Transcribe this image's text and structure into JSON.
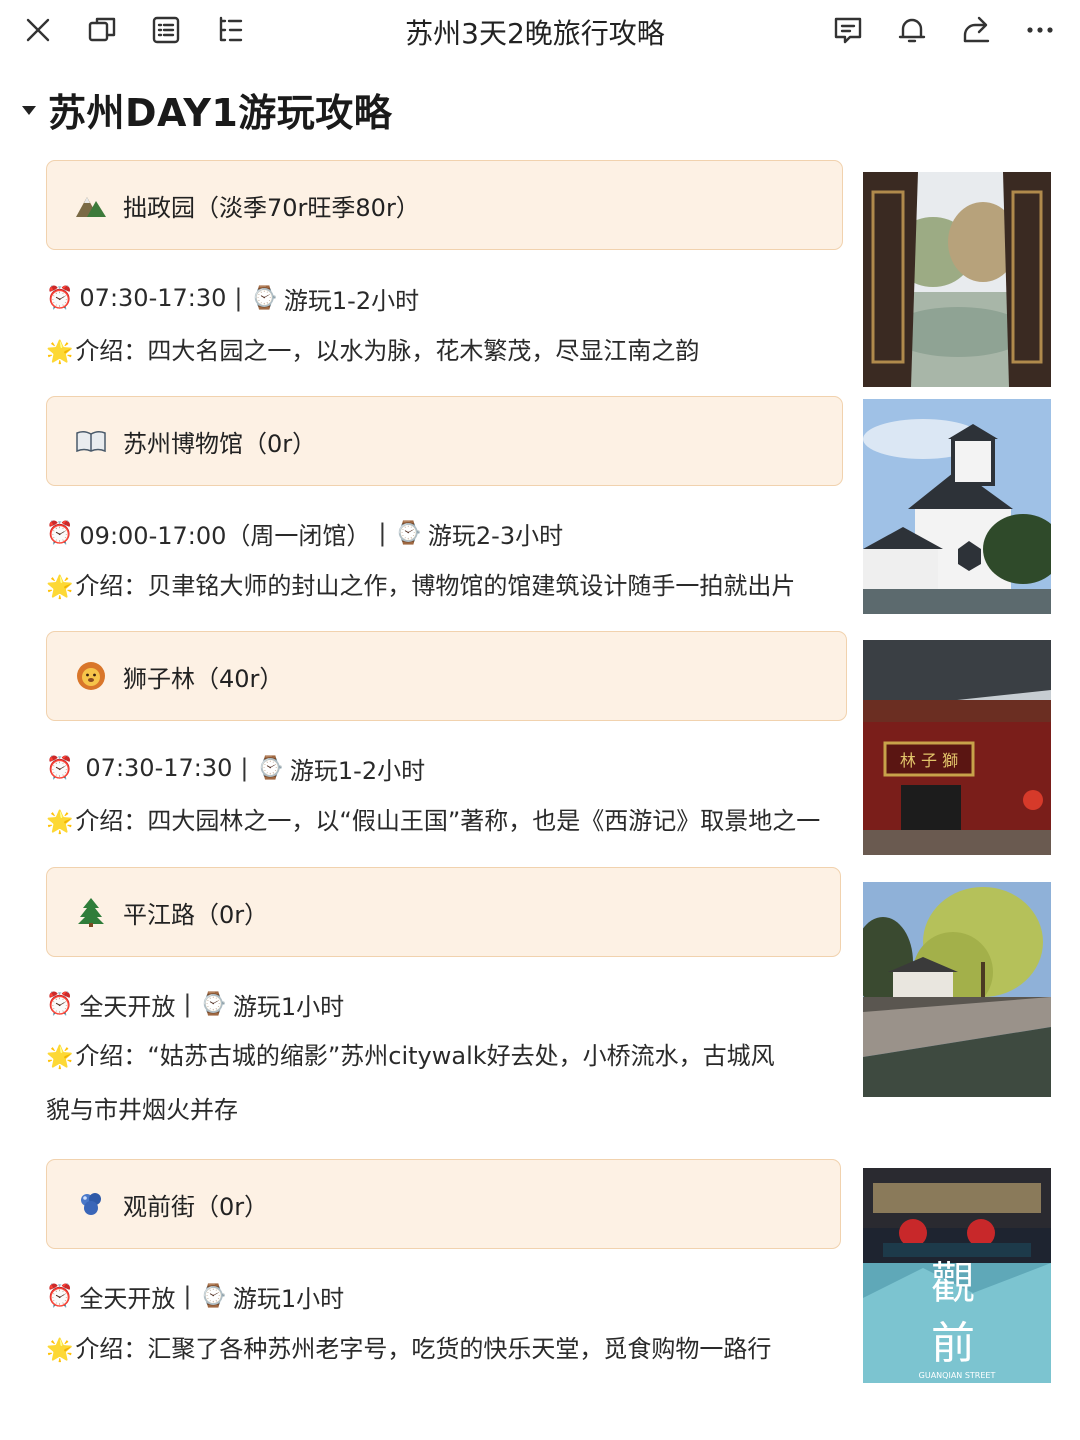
{
  "doc_title": "苏州3天2晚旅行攻略",
  "toolbar_icons": {
    "close": "close-icon",
    "window": "window-icon",
    "outline": "outline-icon",
    "list": "list-tree-icon",
    "comment": "comment-icon",
    "bell": "bell-icon",
    "share": "share-icon",
    "more": "more-icon"
  },
  "heading": "苏州DAY1游玩攻略",
  "attractions": [
    {
      "icon": "mountain-icon",
      "title": "拙政园（淡季70r旺季80r）",
      "hours": "07:30-17:30",
      "duration": "游玩1-2小时",
      "intro": "介绍：四大名园之一，以水为脉，花木繁茂，尽显江南之韵",
      "photo": "garden-window-photo"
    },
    {
      "icon": "book-icon",
      "title": "苏州博物馆（0r）",
      "hours": "09:00-17:00（周一闭馆）",
      "duration": "游玩2-3小时",
      "intro": "介绍：贝聿铭大师的封山之作，博物馆的馆建筑设计随手一拍就出片",
      "photo": "museum-photo"
    },
    {
      "icon": "lion-icon",
      "title": "狮子林（40r）",
      "hours": "07:30-17:30",
      "duration": "游玩1-2小时",
      "intro": "介绍：四大园林之一，以“假山王国”著称，也是《西游记》取景地之一",
      "photo": "lion-grove-gate-photo",
      "photo_sign": "林 子 獅"
    },
    {
      "icon": "pine-tree-icon",
      "title": "平江路（0r）",
      "hours": "全天开放",
      "duration": "游玩1小时",
      "intro": "介绍：“姑苏古城的缩影”苏州citywalk好去处，小桥流水，古城风貌与市井烟火并存",
      "photo": "canal-street-photo"
    },
    {
      "icon": "blue-blob-icon",
      "title": "观前街（0r）",
      "hours": "全天开放",
      "duration": "游玩1小时",
      "intro": "介绍：汇聚了各种苏州老字号，吃货的快乐天堂，觅食购物一路行",
      "photo": "guanqian-street-photo",
      "photo_text_1": "觀",
      "photo_text_2": "前",
      "photo_caption": "GUANQIAN STREET"
    }
  ],
  "glyphs": {
    "clock": "⏰",
    "watch": "⌚",
    "star": "🌟"
  },
  "colors": {
    "callout_bg": "#fdf1e4",
    "callout_border": "#f1d2ae"
  }
}
